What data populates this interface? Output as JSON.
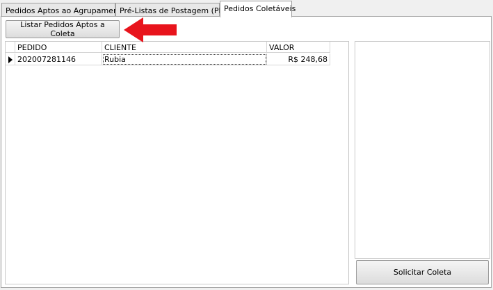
{
  "tabs": [
    {
      "label": "Pedidos Aptos ao Agrupamento",
      "active": false
    },
    {
      "label": "Pré-Listas de Postagem (PLP)",
      "active": false
    },
    {
      "label": "Pedidos Coletáveis",
      "active": true
    }
  ],
  "toolbar": {
    "list_button_label": "Listar Pedidos Aptos a Coleta"
  },
  "grid": {
    "columns": [
      "PEDIDO",
      "CLIENTE",
      "VALOR"
    ],
    "rows": [
      {
        "pedido": "202007281146",
        "cliente": "Rubia",
        "valor": "R$ 248,68"
      }
    ]
  },
  "actions": {
    "solicitar_label": "Solicitar Coleta"
  },
  "colors": {
    "annotation_arrow": "#e8141c"
  }
}
